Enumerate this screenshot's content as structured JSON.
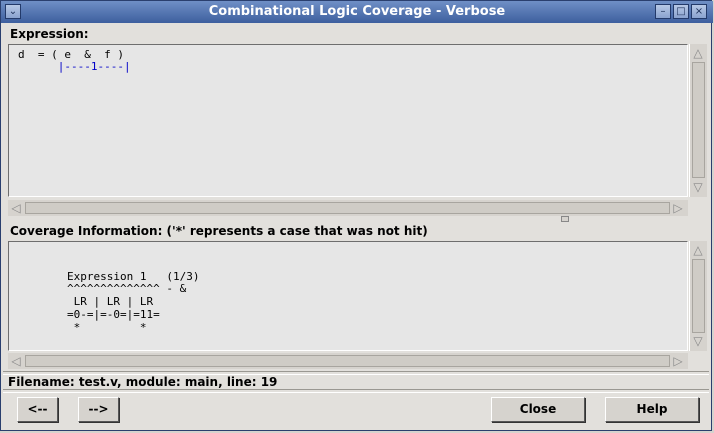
{
  "window": {
    "title": "Combinational Logic Coverage - Verbose",
    "controls": {
      "menu": "⌄",
      "minimize": "–",
      "maximize": "□",
      "close": "×"
    }
  },
  "expression": {
    "label": "Expression:",
    "lines": [
      "d  = ( e  &  f )",
      "      |----1----|"
    ]
  },
  "coverage": {
    "label": "Coverage Information:  ('*' represents a case that was not hit)",
    "lines": [
      "Expression 1   (1/3)",
      "^^^^^^^^^^^^^^ - &",
      " LR | LR | LR",
      "=0-=|=-0=|=11=",
      " *         *"
    ]
  },
  "status": {
    "text": "Filename: test.v, module: main, line: 19"
  },
  "buttons": {
    "prev": "<--",
    "next": "-->",
    "close": "Close",
    "help": "Help"
  },
  "colors": {
    "titlebar": "#4a6aa8",
    "link": "#0000c8"
  }
}
